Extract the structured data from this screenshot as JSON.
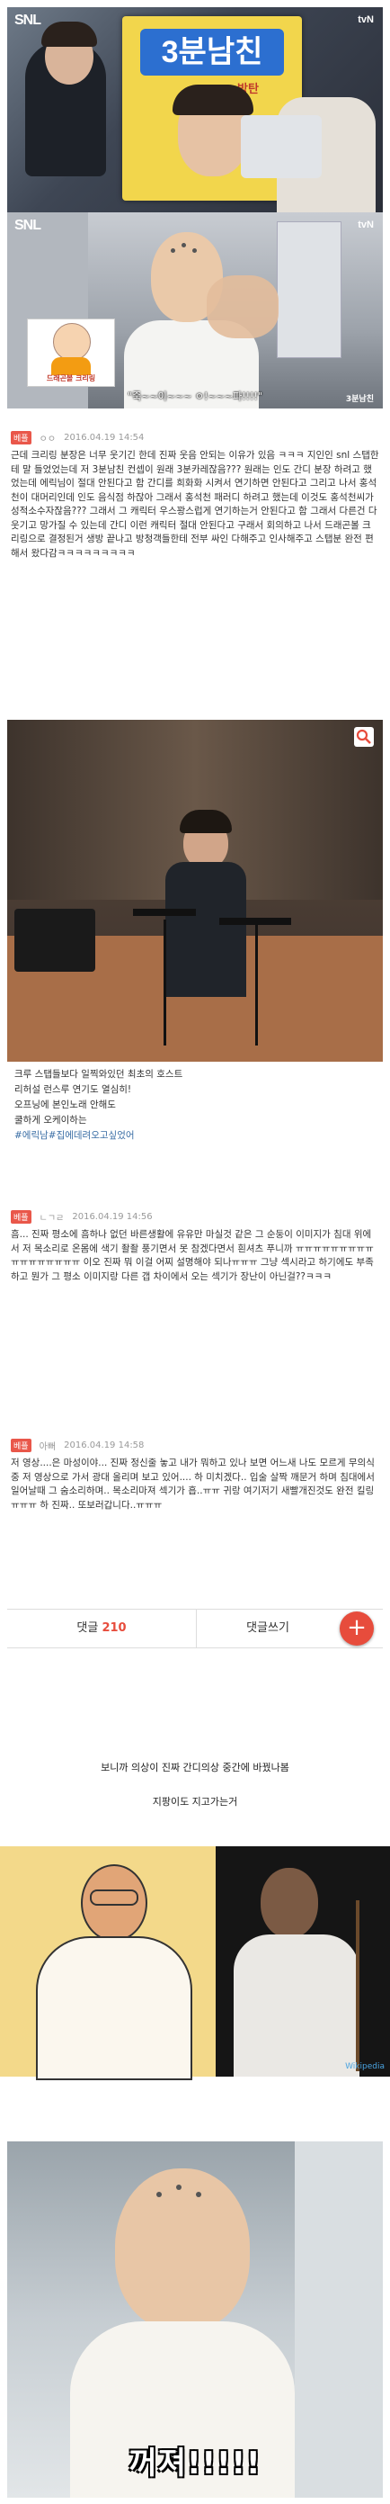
{
  "top_panel_1": {
    "logo": "SNL",
    "channel": "tvN",
    "book_title": "3분남친",
    "book_subtitle": "방탄"
  },
  "top_panel_2": {
    "logo": "SNL",
    "channel": "tvN",
    "label": "드래곤볼 크리링",
    "subtitle": "\"죽~~이~~~ ㅇ!~~~파!!!!\"",
    "corner_tag": "3분남친"
  },
  "comments": [
    {
      "badge": "베플",
      "author": "ㅇㅇ",
      "date": "2016.04.19 14:54",
      "text": "근데 크리링 분장은 너무 웃기긴 한데 진짜 웃음 안되는 이유가 있음 ㅋㅋㅋ 지인인 snl 스탭한테 말 들었었는데 저 3분남친 컨셉이 원래 3분카레잖음??? 원래는 인도 간디 분장 하려고 했었는데 에릭님이 절대 안된다고 함 간디를 희화화 시켜서 연기하면 안된다고 그리고 나서 홍석천이 대머리인데 인도 음식점 하잖아 그래서 홍석천 패러디 하려고 했는데 이것도 홍석천씨가 성적소수자잖음??? 그래서 그 캐릭터 우스꽝스럽게 연기하는거 안된다고 함 그래서 다른건 다 웃기고 망가질 수 있는데 간디 이런 캐릭터 절대 안된다고 구래서 회의하고 나서 드래곤볼 크리링으로 결정된거 생방 끝나고 방청객들한테 전부 싸인 다해주고 인사해주고 스탭분 완전 편해서 왔다감ㅋㅋㅋㅋㅋㅋㅋㅋㅋ"
    },
    {
      "badge": "베플",
      "author": "ㄴㄱㄹ",
      "date": "2016.04.19 14:56",
      "text": "흠... 진짜 평소에 흠하나 없던 바른생활에 유유만 마실것 같은 그 순둥이 이미지가 침대 위에서 저 목소리로 온몸에 색기 좔좔 풍기면서 못 참겠다면서 흰셔츠 푸니까 ㅠㅠㅠㅠㅠㅠㅠㅠㅠㅠㅠㅠㅠㅠㅠㅠㅠ 이오 진짜 뭐 이걸 어찌 설명해야 되나ㅠㅠㅠ 그냥 섹시라고 하기에도 부족하고 뭔가 그 평소 이미지랑 다른 갭 차이에서 오는 섹기가 장난이 아닌걸??ㅋㅋㅋ"
    },
    {
      "badge": "베플",
      "author": "아뻐",
      "date": "2016.04.19 14:58",
      "text": "저 영상....은 마성이야... 진짜 정신줄 놓고 내가 뭐하고 있나 보면 어느새 나도 모르게 무의식중 저 영상으로 가서 광대 올리며 보고 있어.... 하 미치겠다.. 입술 살짝 깨문거 하며 침대에서 일어날때 그 숨소리하며.. 목소리마져 섹기가 흡..ㅠㅠ 귀랑 여기저기 새빨개진것도 완전 킬링ㅠㅠㅠ 하 진짜.. 또보러갑니다..ㅠㅠㅠ"
    }
  ],
  "photo_caption": {
    "line1": "크루 스탭들보다 일찍와있던 최초의 호스트",
    "line2": "리허설 런스루 연기도 열심히!",
    "line3": "오프닝에 본인노래 안해도",
    "line4": "쿨하게 오케이하는",
    "hashtag": "#에릭남#집에데려오고싶었어"
  },
  "bottom_bar": {
    "comments_label": "댓글",
    "comments_count": "210",
    "write_label": "댓글쓰기",
    "plus": "+"
  },
  "middle_text": {
    "line1": "보니까 의상이 진짜 간디의상 중간에 바꿨나봄",
    "line2": "지팡이도 지고가는거"
  },
  "gandhi_panel": {
    "watermark": "Wikipedia"
  },
  "bottom_panel": {
    "subtitle": "꺼져!!!!!"
  },
  "colors": {
    "badge_red": "#e9574a",
    "accent_red": "#e74c3c",
    "link_blue": "#3a6ea5"
  }
}
